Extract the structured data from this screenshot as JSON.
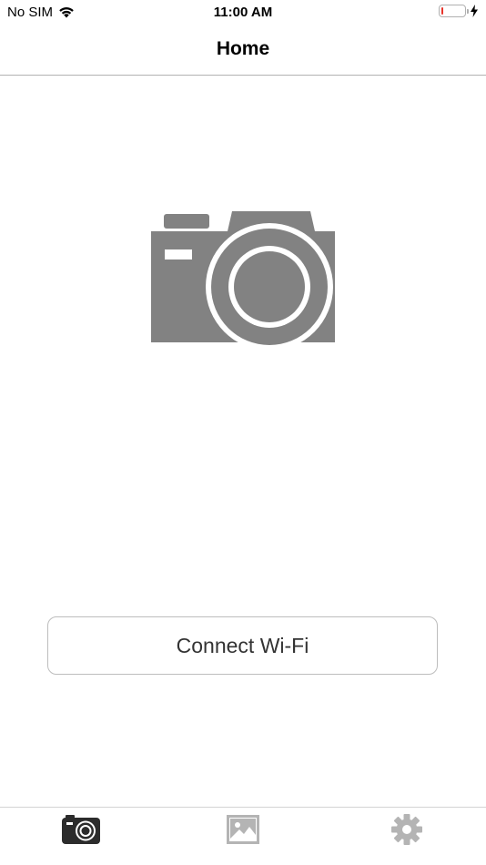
{
  "status_bar": {
    "carrier": "No SIM",
    "time": "11:00 AM",
    "battery_fraction": 0.06,
    "battery_color": "#e8332a"
  },
  "nav": {
    "title": "Home"
  },
  "main": {
    "illustration_icon": "camera-icon",
    "connect_button_label": "Connect Wi-Fi"
  },
  "tab_bar": {
    "items": [
      {
        "icon": "camera-tab-icon",
        "selected": true
      },
      {
        "icon": "photo-gallery-icon",
        "selected": false
      },
      {
        "icon": "gear-icon",
        "selected": false
      }
    ]
  },
  "colors": {
    "illustration_gray": "#828282",
    "tab_active": "#2c2c2c",
    "tab_inactive": "#b4b4b4"
  }
}
